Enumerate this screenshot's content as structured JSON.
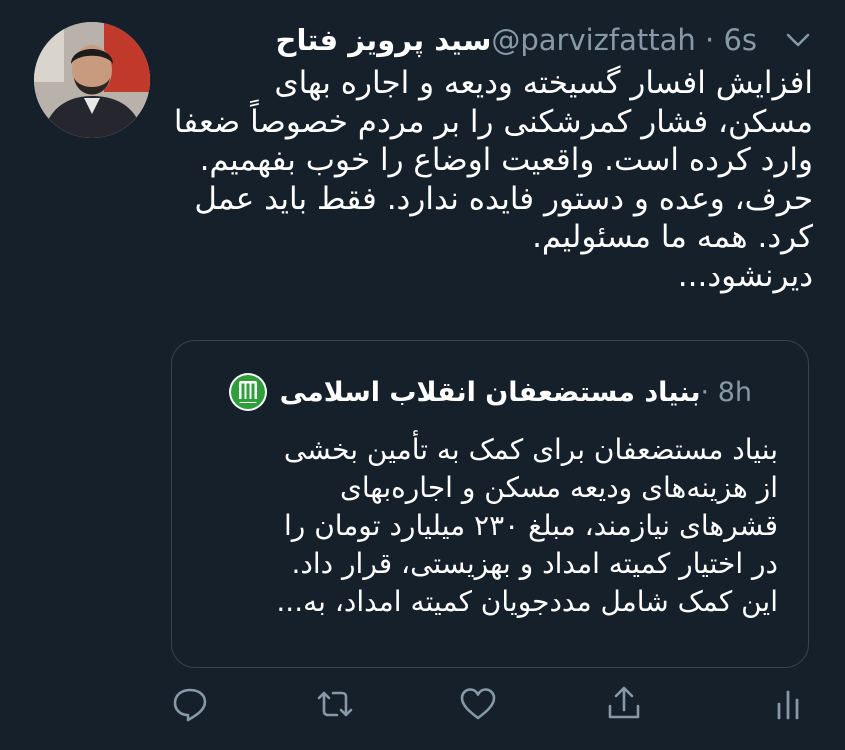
{
  "tweet": {
    "author_name": "سید پرویز فتاح",
    "handle": "@parvizfattah",
    "separator": "·",
    "time": "6s",
    "text_lines": [
      "افزایش افسار گسیخته ودیعه و اجاره بهای",
      "مسکن، فشار کمرشکنی را بر مردم خصوصاً ضعفا",
      "وارد کرده است. واقعیت اوضاع را خوب بفهمیم.",
      "حرف، وعده و دستور فایده ندارد. فقط باید عمل",
      "کرد. همه ما مسئولیم.",
      "دیرنشود..."
    ],
    "avatar_icon": "author-avatar-photo",
    "menu_icon": "chevron-down-icon"
  },
  "quoted_tweet": {
    "author_name": "بنیاد مستضعفان انقلاب اسلامی",
    "separator": "·",
    "time": "8h",
    "logo_icon": "foundation-logo-icon",
    "text_lines": [
      "بنیاد مستضعفان برای کمک به تأمین بخشی",
      "از هزینه‌های ودیعه مسکن و اجاره‌بهای",
      "قشرهای نیازمند، مبلغ ۲۳۰ میلیارد تومان را",
      "در اختیار کمیته امداد و بهزیستی، قرار داد.",
      "این کمک شامل مددجویان کمیته امداد، به..."
    ]
  },
  "actions": [
    "reply-icon",
    "retweet-icon",
    "like-icon",
    "share-icon",
    "analytics-icon"
  ],
  "colors": {
    "background": "#15202b",
    "text": "#ffffff",
    "secondary_text": "#8899a6",
    "border": "#38444d",
    "logo_green": "#2e9e3a"
  }
}
